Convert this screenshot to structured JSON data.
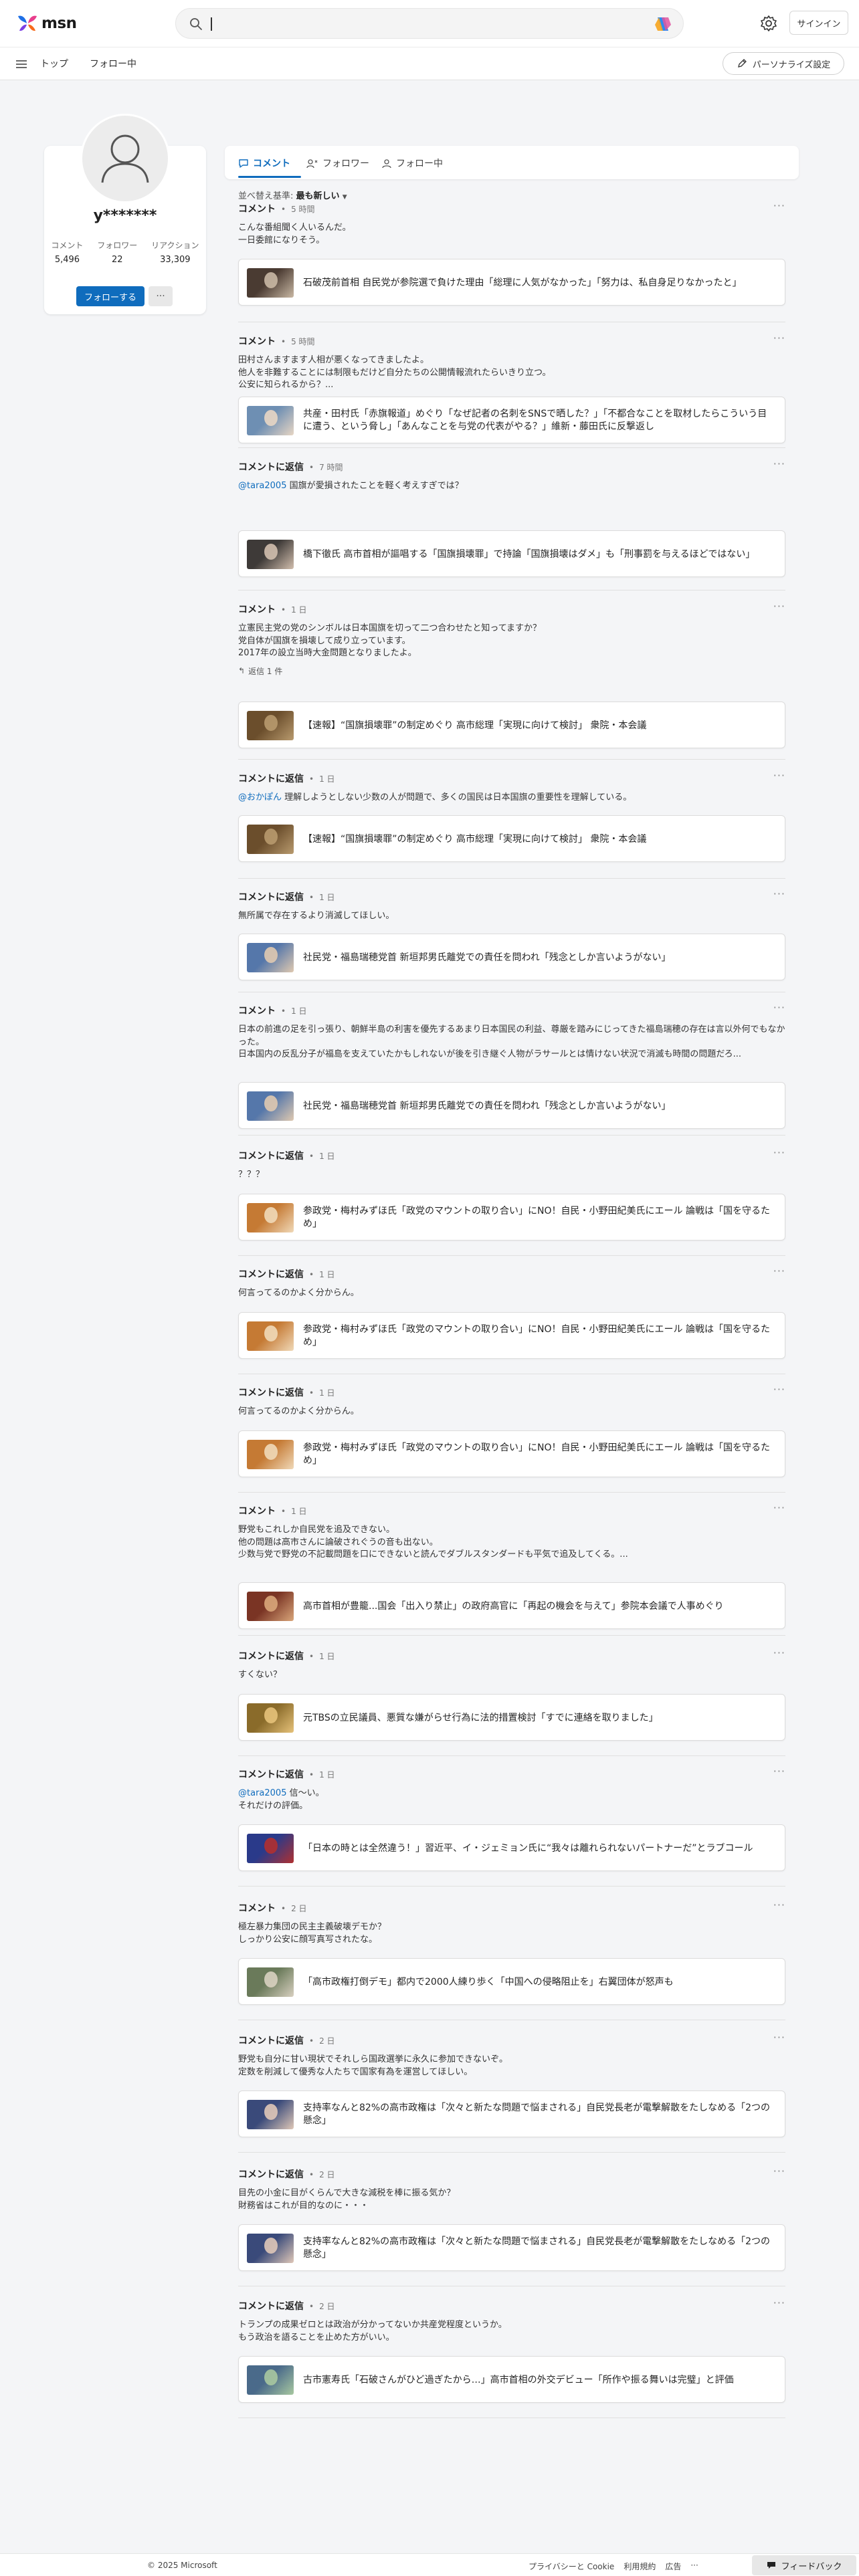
{
  "header": {
    "logo_text": "msn",
    "search_placeholder": "",
    "signin_label": "サインイン"
  },
  "nav": {
    "tabs": [
      "トップ",
      "フォロー中"
    ],
    "personalize_label": "パーソナライズ設定"
  },
  "profile": {
    "username": "y*******",
    "stats": [
      {
        "label": "コメント",
        "value": "5,496"
      },
      {
        "label": "フォロワー",
        "value": "22"
      },
      {
        "label": "リアクション",
        "value": "33,309"
      }
    ],
    "follow_label": "フォローする",
    "more_label": "···"
  },
  "tabs": [
    "コメント",
    "フォロワー",
    "フォロー中"
  ],
  "sort": {
    "label": "並べ替え基準:",
    "value": "最も新しい"
  },
  "feed": [
    {
      "type": "コメント",
      "time": "5 時間",
      "mention": "",
      "body": "こんな番組聞く人いるんだ。\n一日委館になりそう。",
      "replies": "",
      "article": "石破茂前首相 自民党が参院選で負けた理由「総理に人気がなかった」「努力は、私自身足りなかったと」"
    },
    {
      "type": "コメント",
      "time": "5 時間",
      "mention": "",
      "body": "田村さんますます人相が悪くなってきましたよ。\n他人を非難することには制限もだけど自分たちの公開情報流れたらいきり立つ。\n公安に知られるから？...",
      "replies": "",
      "article": "共産・田村氏「赤旗報道」めぐり「なぜ記者の名刺をSNSで晒した？」「不都合なことを取材したらこういう目に遭う、という脅し」「あんなことを与党の代表がやる？」維新・藤田氏に反撃返し"
    },
    {
      "type": "コメントに返信",
      "time": "7 時間",
      "mention": "@tara2005",
      "body": " 国旗が愛損されたことを軽く考えすぎでは？",
      "replies": "",
      "article": "橋下徹氏 高市首相が謳唱する「国旗損壊罪」で持論「国旗損壊はダメ」も「刑事罰を与えるほどではない」"
    },
    {
      "type": "コメント",
      "time": "1 日",
      "mention": "",
      "body": "立憲民主党の党のシンボルは日本国旗を切って二つ合わせたと知ってますか？\n党自体が国旗を損壊して成り立っています。\n2017年の設立当時大金問題となりましたよ。",
      "replies": "返信 1 件",
      "article": "【速報】“国旗損壊罪”の制定めぐり 高市総理「実現に向けて検討」 衆院・本会議"
    },
    {
      "type": "コメントに返信",
      "time": "1 日",
      "mention": "@おかぽん",
      "body": " 理解しようとしない少数の人が問題で、多くの国民は日本国旗の重要性を理解している。",
      "replies": "",
      "article": "【速報】“国旗損壊罪”の制定めぐり 高市総理「実現に向けて検討」 衆院・本会議"
    },
    {
      "type": "コメントに返信",
      "time": "1 日",
      "mention": "",
      "body": "無所属で存在するより消滅してほしい。",
      "replies": "",
      "article": "社民党・福島瑞穂党首 新垣邦男氏離党での責任を問われ「残念としか言いようがない」"
    },
    {
      "type": "コメント",
      "time": "1 日",
      "mention": "",
      "body": "日本の前進の足を引っ張り、朝鮮半島の利害を優先するあまり日本国民の利益、尊厳を踏みにじってきた福島瑞穂の存在は言以外何でもなかった。\n日本国内の反乱分子が福島を支えていたかもしれないが後を引き継ぐ人物がラサールとは情けない状況で消滅も時間の問題だろ...",
      "replies": "",
      "article": "社民党・福島瑞穂党首 新垣邦男氏離党での責任を問われ「残念としか言いようがない」"
    },
    {
      "type": "コメントに返信",
      "time": "1 日",
      "mention": "",
      "body": "？？？",
      "replies": "",
      "article": "参政党・梅村みずほ氏「政党のマウントの取り合い」にNO！自民・小野田紀美氏にエール 論戦は「国を守るため」"
    },
    {
      "type": "コメントに返信",
      "time": "1 日",
      "mention": "",
      "body": "何言ってるのかよく分からん。",
      "replies": "",
      "article": "参政党・梅村みずほ氏「政党のマウントの取り合い」にNO！自民・小野田紀美氏にエール 論戦は「国を守るため」"
    },
    {
      "type": "コメントに返信",
      "time": "1 日",
      "mention": "",
      "body": "何言ってるのかよく分からん。",
      "replies": "",
      "article": "参政党・梅村みずほ氏「政党のマウントの取り合い」にNO！自民・小野田紀美氏にエール 論戦は「国を守るため」"
    },
    {
      "type": "コメント",
      "time": "1 日",
      "mention": "",
      "body": "野党もこれしか自民党を追及できない。\n他の問題は高市さんに論破されぐうの音も出ない。\n少数与党で野党の不記載問題を口にできないと読んでダブルスタンダードも平気で追及してくる。...",
      "replies": "",
      "article": "高市首相が豊籠...国会「出入り禁止」の政府高官に「再起の機会を与えて」参院本会議で人事めぐり"
    },
    {
      "type": "コメントに返信",
      "time": "1 日",
      "mention": "",
      "body": "すくない？",
      "replies": "",
      "article": "元TBSの立民議員、悪質な嫌がらせ行為に法的措置検討「すでに連絡を取りました」"
    },
    {
      "type": "コメントに返信",
      "time": "1 日",
      "mention": "@tara2005",
      "body": " 信〜い。\nそれだけの評価。",
      "replies": "",
      "article": "「日本の時とは全然違う！」習近平、イ・ジェミョン氏に“我々は離れられないパートナーだ”とラブコール"
    },
    {
      "type": "コメント",
      "time": "2 日",
      "mention": "",
      "body": "極左暴力集団の民主主義破壊デモか？\nしっかり公安に顔写真写されたな。",
      "replies": "",
      "article": "「高市政権打倒デモ」都内で2000人練り歩く「中国への侵略阻止を」右翼団体が怒声も"
    },
    {
      "type": "コメントに返信",
      "time": "2 日",
      "mention": "",
      "body": "野党も自分に甘い現状でそれしら国政選挙に永久に参加できないぞ。\n定数を削減して優秀な人たちで国家有為を運営してほしい。",
      "replies": "",
      "article": "支持率なんと82%の高市政権は「次々と新たな問題で悩まされる」自民党長老が電撃解散をたしなめる「2つの懸念」"
    },
    {
      "type": "コメントに返信",
      "time": "2 日",
      "mention": "",
      "body": "目先の小金に目がくらんで大きな減税を棒に振る気か？\n財務省はこれが目的なのに・・・",
      "replies": "",
      "article": "支持率なんと82%の高市政権は「次々と新たな問題で悩まされる」自民党長老が電撃解散をたしなめる「2つの懸念」"
    },
    {
      "type": "コメントに返信",
      "time": "2 日",
      "mention": "",
      "body": "トランプの成果ゼロとは政治が分かってないか共産党程度というか。\nもう政治を語ることを止めた方がいい。",
      "replies": "",
      "article": "古市憲寿氏「石破さんがひど過ぎたから…」高市首相の外交デビュー「所作や振る舞いは完璧」と評価"
    }
  ],
  "footer": {
    "copyright": "© 2025 Microsoft",
    "links": [
      "プライバシーと Cookie",
      "利用規約",
      "広告",
      "···"
    ],
    "feedback_label": "フィードバック"
  }
}
